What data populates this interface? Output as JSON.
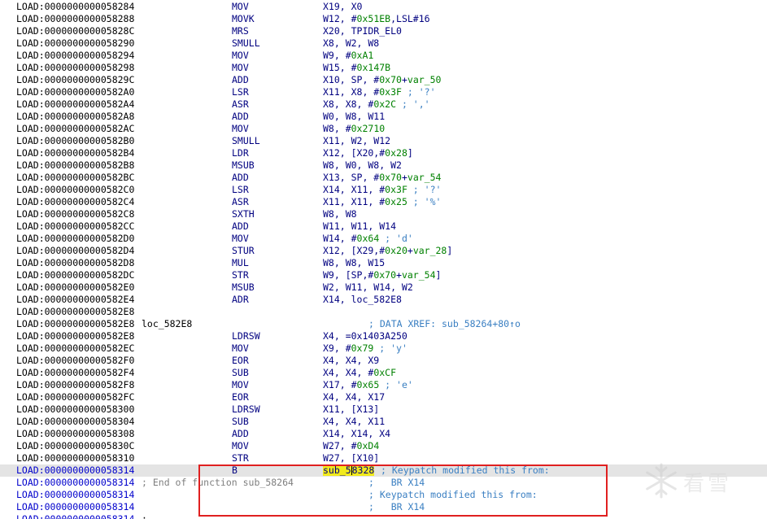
{
  "rows": [
    {
      "addr": "LOAD:0000000000058284",
      "mnemonic": "MOV",
      "operands": [
        {
          "t": "X19, X0"
        }
      ]
    },
    {
      "addr": "LOAD:0000000000058288",
      "mnemonic": "MOVK",
      "operands": [
        {
          "t": "W12, #"
        },
        {
          "t": "0x51EB",
          "k": "imm"
        },
        {
          "t": ",LSL#16"
        }
      ]
    },
    {
      "addr": "LOAD:000000000005828C",
      "mnemonic": "MRS",
      "operands": [
        {
          "t": "X20, TPIDR_EL0"
        }
      ]
    },
    {
      "addr": "LOAD:0000000000058290",
      "mnemonic": "SMULL",
      "operands": [
        {
          "t": "X8, W2, W8"
        }
      ]
    },
    {
      "addr": "LOAD:0000000000058294",
      "mnemonic": "MOV",
      "operands": [
        {
          "t": "W9, #"
        },
        {
          "t": "0xA1",
          "k": "imm"
        }
      ]
    },
    {
      "addr": "LOAD:0000000000058298",
      "mnemonic": "MOV",
      "operands": [
        {
          "t": "W15, #"
        },
        {
          "t": "0x147B",
          "k": "imm"
        }
      ]
    },
    {
      "addr": "LOAD:000000000005829C",
      "mnemonic": "ADD",
      "operands": [
        {
          "t": "X10, SP, #"
        },
        {
          "t": "0x70",
          "k": "imm"
        },
        {
          "t": "+"
        },
        {
          "t": "var_50",
          "k": "imm"
        }
      ]
    },
    {
      "addr": "LOAD:00000000000582A0",
      "mnemonic": "LSR",
      "operands": [
        {
          "t": "X11, X8, #"
        },
        {
          "t": "0x3F",
          "k": "imm"
        },
        {
          "t": " ; '?'",
          "k": "cmt"
        }
      ]
    },
    {
      "addr": "LOAD:00000000000582A4",
      "mnemonic": "ASR",
      "operands": [
        {
          "t": "X8, X8, #"
        },
        {
          "t": "0x2C",
          "k": "imm"
        },
        {
          "t": " ; ','",
          "k": "cmt"
        }
      ]
    },
    {
      "addr": "LOAD:00000000000582A8",
      "mnemonic": "ADD",
      "operands": [
        {
          "t": "W0, W8, W11"
        }
      ]
    },
    {
      "addr": "LOAD:00000000000582AC",
      "mnemonic": "MOV",
      "operands": [
        {
          "t": "W8, #"
        },
        {
          "t": "0x2710",
          "k": "imm"
        }
      ]
    },
    {
      "addr": "LOAD:00000000000582B0",
      "mnemonic": "SMULL",
      "operands": [
        {
          "t": "X11, W2, W12"
        }
      ]
    },
    {
      "addr": "LOAD:00000000000582B4",
      "mnemonic": "LDR",
      "operands": [
        {
          "t": "X12, [X20,#"
        },
        {
          "t": "0x28",
          "k": "imm"
        },
        {
          "t": "]"
        }
      ]
    },
    {
      "addr": "LOAD:00000000000582B8",
      "mnemonic": "MSUB",
      "operands": [
        {
          "t": "W8, W0, W8, W2"
        }
      ]
    },
    {
      "addr": "LOAD:00000000000582BC",
      "mnemonic": "ADD",
      "operands": [
        {
          "t": "X13, SP, #"
        },
        {
          "t": "0x70",
          "k": "imm"
        },
        {
          "t": "+"
        },
        {
          "t": "var_54",
          "k": "imm"
        }
      ]
    },
    {
      "addr": "LOAD:00000000000582C0",
      "mnemonic": "LSR",
      "operands": [
        {
          "t": "X14, X11, #"
        },
        {
          "t": "0x3F",
          "k": "imm"
        },
        {
          "t": " ; '?'",
          "k": "cmt"
        }
      ]
    },
    {
      "addr": "LOAD:00000000000582C4",
      "mnemonic": "ASR",
      "operands": [
        {
          "t": "X11, X11, #"
        },
        {
          "t": "0x25",
          "k": "imm"
        },
        {
          "t": " ; '%'",
          "k": "cmt"
        }
      ]
    },
    {
      "addr": "LOAD:00000000000582C8",
      "mnemonic": "SXTH",
      "operands": [
        {
          "t": "W8, W8"
        }
      ]
    },
    {
      "addr": "LOAD:00000000000582CC",
      "mnemonic": "ADD",
      "operands": [
        {
          "t": "W11, W11, W14"
        }
      ]
    },
    {
      "addr": "LOAD:00000000000582D0",
      "mnemonic": "MOV",
      "operands": [
        {
          "t": "W14, #"
        },
        {
          "t": "0x64",
          "k": "imm"
        },
        {
          "t": " ; 'd'",
          "k": "cmt"
        }
      ]
    },
    {
      "addr": "LOAD:00000000000582D4",
      "mnemonic": "STUR",
      "operands": [
        {
          "t": "X12, [X29,#"
        },
        {
          "t": "0x20",
          "k": "imm"
        },
        {
          "t": "+"
        },
        {
          "t": "var_28",
          "k": "imm"
        },
        {
          "t": "]"
        }
      ]
    },
    {
      "addr": "LOAD:00000000000582D8",
      "mnemonic": "MUL",
      "operands": [
        {
          "t": "W8, W8, W15"
        }
      ]
    },
    {
      "addr": "LOAD:00000000000582DC",
      "mnemonic": "STR",
      "operands": [
        {
          "t": "W9, [SP,#"
        },
        {
          "t": "0x70",
          "k": "imm"
        },
        {
          "t": "+"
        },
        {
          "t": "var_54",
          "k": "imm"
        },
        {
          "t": "]"
        }
      ]
    },
    {
      "addr": "LOAD:00000000000582E0",
      "mnemonic": "MSUB",
      "operands": [
        {
          "t": "W2, W11, W14, W2"
        }
      ]
    },
    {
      "addr": "LOAD:00000000000582E4",
      "mnemonic": "ADR",
      "operands": [
        {
          "t": "X14, loc_582E8"
        }
      ]
    },
    {
      "addr": "LOAD:00000000000582E8",
      "mnemonic": "",
      "operands": []
    },
    {
      "addr": "LOAD:00000000000582E8",
      "label": "loc_582E8",
      "xref": "; DATA XREF: sub_58264+80↑o",
      "mnemonic": "",
      "operands": []
    },
    {
      "addr": "LOAD:00000000000582E8",
      "mnemonic": "LDRSW",
      "operands": [
        {
          "t": "X4, =0x1403A250"
        }
      ]
    },
    {
      "addr": "LOAD:00000000000582EC",
      "mnemonic": "MOV",
      "operands": [
        {
          "t": "X9, #"
        },
        {
          "t": "0x79",
          "k": "imm"
        },
        {
          "t": " ; 'y'",
          "k": "cmt"
        }
      ]
    },
    {
      "addr": "LOAD:00000000000582F0",
      "mnemonic": "EOR",
      "operands": [
        {
          "t": "X4, X4, X9"
        }
      ]
    },
    {
      "addr": "LOAD:00000000000582F4",
      "mnemonic": "SUB",
      "operands": [
        {
          "t": "X4, X4, #"
        },
        {
          "t": "0xCF",
          "k": "imm"
        }
      ]
    },
    {
      "addr": "LOAD:00000000000582F8",
      "mnemonic": "MOV",
      "operands": [
        {
          "t": "X17, #"
        },
        {
          "t": "0x65",
          "k": "imm"
        },
        {
          "t": " ; 'e'",
          "k": "cmt"
        }
      ]
    },
    {
      "addr": "LOAD:00000000000582FC",
      "mnemonic": "EOR",
      "operands": [
        {
          "t": "X4, X4, X17"
        }
      ]
    },
    {
      "addr": "LOAD:0000000000058300",
      "mnemonic": "LDRSW",
      "operands": [
        {
          "t": "X11, [X13]"
        }
      ]
    },
    {
      "addr": "LOAD:0000000000058304",
      "mnemonic": "SUB",
      "operands": [
        {
          "t": "X4, X4, X11"
        }
      ]
    },
    {
      "addr": "LOAD:0000000000058308",
      "mnemonic": "ADD",
      "operands": [
        {
          "t": "X14, X14, X4"
        }
      ]
    },
    {
      "addr": "LOAD:000000000005830C",
      "mnemonic": "MOV",
      "operands": [
        {
          "t": "W27, #"
        },
        {
          "t": "0xD4",
          "k": "imm"
        }
      ]
    },
    {
      "addr": "LOAD:0000000000058310",
      "mnemonic": "STR",
      "operands": [
        {
          "t": "W27, [X10]"
        }
      ]
    },
    {
      "addr": "LOAD:0000000000058314",
      "mnemonic": "B",
      "operands": [
        {
          "t": "sub_5",
          "k": "sym"
        },
        {
          "t": "",
          "k": "cursor"
        },
        {
          "t": "8328",
          "k": "sym"
        }
      ],
      "inline_comment": "; Keypatch modified this from:",
      "highlight": true,
      "blue": true
    },
    {
      "addr": "LOAD:0000000000058314",
      "label": "; End of function sub_58264",
      "label_gray": true,
      "sub_comment": ";   BR X14",
      "mnemonic": "",
      "operands": [],
      "blue": true
    },
    {
      "addr": "LOAD:0000000000058314",
      "sub_comment": "; Keypatch modified this from:",
      "mnemonic": "",
      "operands": [],
      "blue": true
    },
    {
      "addr": "LOAD:0000000000058314",
      "sub_comment": ";   BR X14",
      "mnemonic": "",
      "operands": [],
      "blue": true
    },
    {
      "addr": "LOAD:0000000000058314",
      "label": ";",
      "mnemonic": "",
      "operands": [],
      "blue": true
    }
  ],
  "watermark": {
    "text": "看雪",
    "icon": "snowflake-logo-icon"
  }
}
